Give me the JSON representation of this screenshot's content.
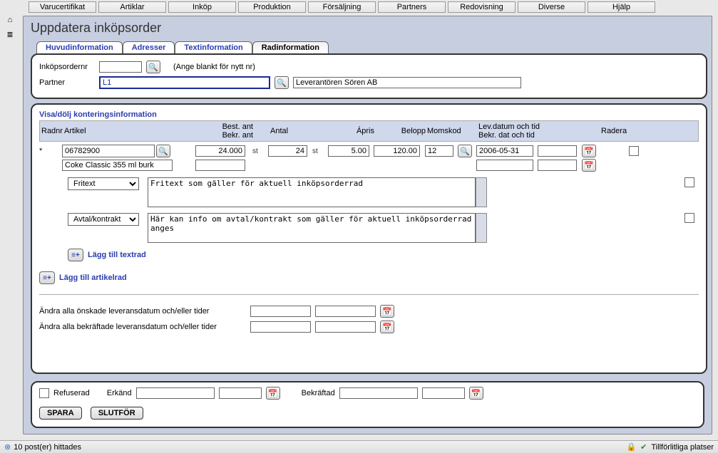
{
  "menu": [
    "Varucertifikat",
    "Artiklar",
    "Inköp",
    "Produktion",
    "Försäljning",
    "Partners",
    "Redovisning",
    "Diverse",
    "Hjälp"
  ],
  "title": "Uppdatera inköpsorder",
  "tabs": [
    "Huvudinformation",
    "Adresser",
    "Textinformation",
    "Radinformation"
  ],
  "head": {
    "ordernr_label": "Inköpsordernr",
    "ordernr_value": "",
    "ordernr_hint": "(Ange blankt för nytt nr)",
    "partner_label": "Partner",
    "partner_code": "L1",
    "partner_name": "Leverantören Sören AB"
  },
  "section_title": "Visa/dölj konteringsinformation",
  "cols": {
    "radnr": "Radnr",
    "artikel": "Artikel",
    "best": "Best. ant\nBekr. ant",
    "antal": "Antal",
    "apris": "Ápris",
    "belopp": "Belopp",
    "momskod": "Momskod",
    "lev": "Lev.datum och tid\nBekr. dat och tid",
    "radera": "Radera"
  },
  "line": {
    "marker": "*",
    "article": "06782900",
    "article_desc": "Coke Classic 355 ml burk",
    "best_ant": "24.000",
    "bekr_ant": "",
    "unit1": "st",
    "antal": "24",
    "unit2": "st",
    "apris": "5.00",
    "belopp": "120.00",
    "momskod": "12",
    "lev_date": "2006-05-31",
    "lev_time": "",
    "bekr_date": "",
    "bekr_time": ""
  },
  "text_selects": {
    "fritext": "Fritext",
    "avtal": "Avtal/kontrakt"
  },
  "text_values": {
    "fritext": "Fritext som gäller för aktuell inköpsorderrad",
    "avtal": "Här kan info om avtal/kontrakt som gäller för aktuell inköpsorderrad anges"
  },
  "links": {
    "add_textrad": "Lägg till textrad",
    "add_artikelrad": "Lägg till artikelrad"
  },
  "bulk": {
    "onskade": "Ändra alla önskade leveransdatum och/eller tider",
    "bekraftade": "Ändra alla bekräftade leveransdatum och/eller tider"
  },
  "footer": {
    "refuserad": "Refuserad",
    "erkand": "Erkänd",
    "bekraftad": "Bekräftad",
    "spara": "SPARA",
    "slutfor": "SLUTFÖR"
  },
  "status": {
    "left": "10 post(er) hittades",
    "right": "Tillförlitliga platser"
  }
}
